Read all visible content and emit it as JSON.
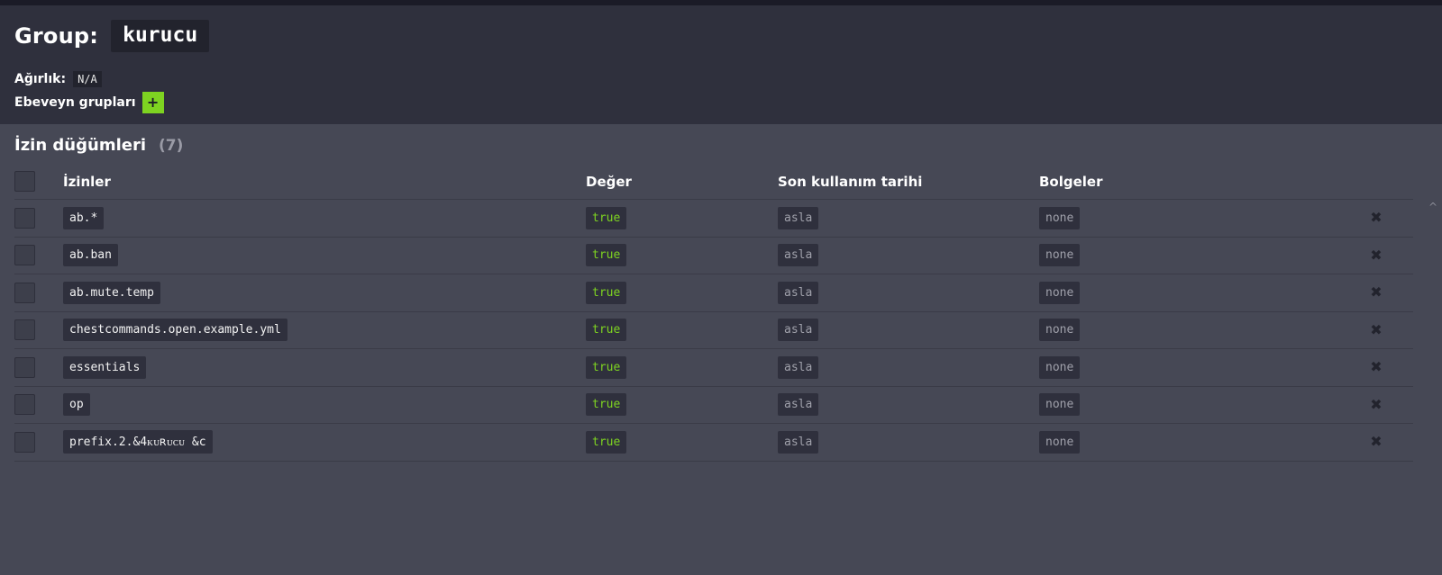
{
  "header": {
    "group_label": "Group:",
    "group_name": "kurucu",
    "weight_label": "Ağırlık:",
    "weight_value": "N/A",
    "parents_label": "Ebeveyn grupları",
    "add_parent_icon": "+"
  },
  "permissions": {
    "title": "İzin düğümleri",
    "count": "(7)",
    "columns": {
      "permission": "İzinler",
      "value": "Değer",
      "expiry": "Son kullanım tarihi",
      "regions": "Bolgeler"
    },
    "rows": [
      {
        "node": "ab.*",
        "value": "true",
        "expiry": "asla",
        "regions": "none"
      },
      {
        "node": "ab.ban",
        "value": "true",
        "expiry": "asla",
        "regions": "none"
      },
      {
        "node": "ab.mute.temp",
        "value": "true",
        "expiry": "asla",
        "regions": "none"
      },
      {
        "node": "chestcommands.open.example.yml",
        "value": "true",
        "expiry": "asla",
        "regions": "none"
      },
      {
        "node": "essentials",
        "value": "true",
        "expiry": "asla",
        "regions": "none"
      },
      {
        "node": "op",
        "value": "true",
        "expiry": "asla",
        "regions": "none"
      },
      {
        "node": "prefix.2.&4ᴋᴜʀᴜᴄᴜ &c",
        "value": "true",
        "expiry": "asla",
        "regions": "none"
      }
    ],
    "delete_icon": "✖",
    "scroll_icon": "^"
  },
  "colors": {
    "accent_green": "#7ed321",
    "header_bg": "#2f303d",
    "body_bg": "#464855"
  }
}
